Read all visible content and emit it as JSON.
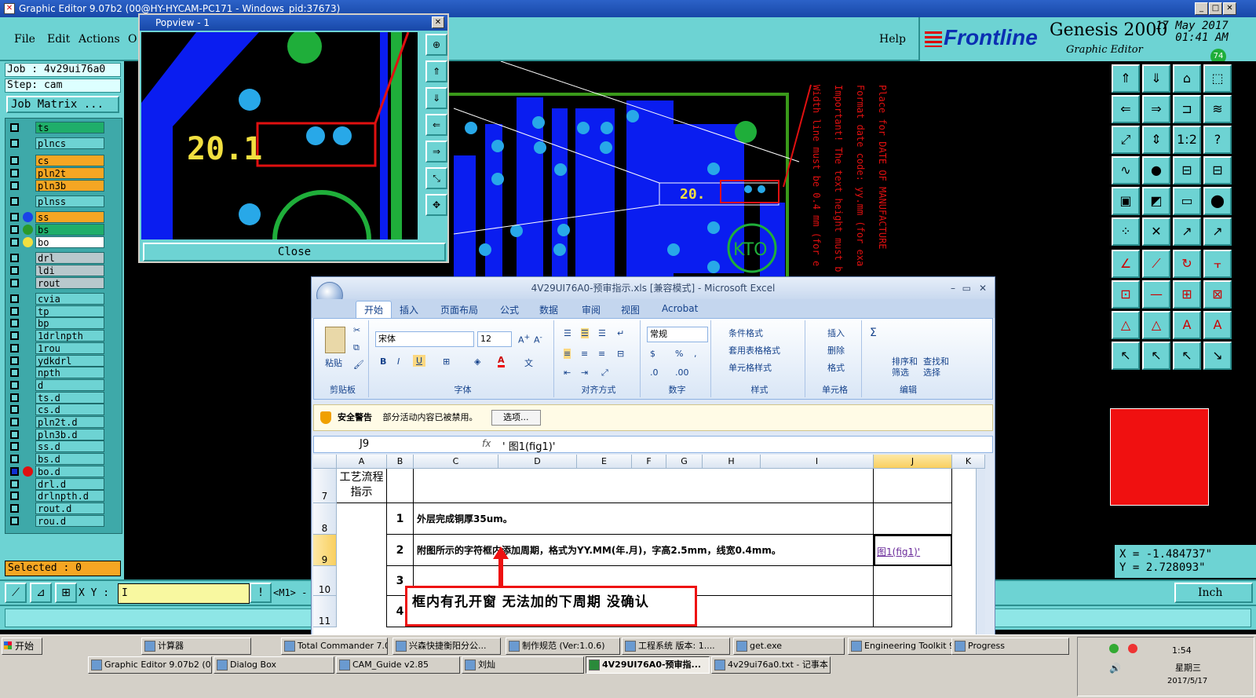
{
  "window": {
    "title": "Graphic Editor 9.07b2 (00@HY-HYCAM-PC171 - Windows_pid:37673)"
  },
  "menu": {
    "file": "File",
    "edit": "Edit",
    "actions": "Actions",
    "o": "O",
    "help": "Help"
  },
  "brand": {
    "logo": "Frontline",
    "product": "Genesis 2000",
    "subtitle": "Graphic Editor",
    "date": "17 May 2017",
    "time": "01:41 AM",
    "badge": "74"
  },
  "job": {
    "job": "Job : 4v29ui76a0",
    "step": "Step: cam",
    "matrix": "Job Matrix ..."
  },
  "layers": [
    {
      "name": "ts",
      "color": "#1fae6a"
    },
    {
      "name": "plncs",
      "color": "#6dd3d3"
    },
    {
      "name": "cs",
      "color": "#f5a623"
    },
    {
      "name": "pln2t",
      "color": "#f5a623"
    },
    {
      "name": "pln3b",
      "color": "#f5a623"
    },
    {
      "name": "plnss",
      "color": "#6dd3d3"
    },
    {
      "name": "ss",
      "color": "#f5a623"
    },
    {
      "name": "bs",
      "color": "#1fae6a"
    },
    {
      "name": "bo",
      "color": "#ffffff"
    },
    {
      "name": "drl",
      "color": "#b8c8cc"
    },
    {
      "name": "ldi",
      "color": "#b8c8cc"
    },
    {
      "name": "rout",
      "color": "#b8c8cc"
    },
    {
      "name": "cvia",
      "color": "#6dd3d3"
    },
    {
      "name": "tp",
      "color": "#6dd3d3"
    },
    {
      "name": "bp",
      "color": "#6dd3d3"
    },
    {
      "name": "1drlnpth",
      "color": "#6dd3d3"
    },
    {
      "name": "1rou",
      "color": "#6dd3d3"
    },
    {
      "name": "ydkdrl",
      "color": "#6dd3d3"
    },
    {
      "name": "npth",
      "color": "#6dd3d3"
    },
    {
      "name": "d",
      "color": "#6dd3d3"
    },
    {
      "name": "ts.d",
      "color": "#6dd3d3"
    },
    {
      "name": "cs.d",
      "color": "#6dd3d3"
    },
    {
      "name": "pln2t.d",
      "color": "#6dd3d3"
    },
    {
      "name": "pln3b.d",
      "color": "#6dd3d3"
    },
    {
      "name": "ss.d",
      "color": "#6dd3d3"
    },
    {
      "name": "bs.d",
      "color": "#6dd3d3"
    },
    {
      "name": "bo.d",
      "color": "#6dd3d3"
    },
    {
      "name": "drl.d",
      "color": "#6dd3d3"
    },
    {
      "name": "drlnpth.d",
      "color": "#6dd3d3"
    },
    {
      "name": "rout.d",
      "color": "#6dd3d3"
    },
    {
      "name": "rou.d",
      "color": "#6dd3d3"
    }
  ],
  "selected": "Selected : 0",
  "xy": {
    "label": "X Y :",
    "value": "I",
    "m1": "<M1> -"
  },
  "coords": {
    "x": "X = -1.484737\"",
    "y": "Y = 2.728093\""
  },
  "units": "Inch",
  "popview": {
    "title": "Popview - 1",
    "close": "Close",
    "text": "20.1"
  },
  "board": {
    "marking": "20.",
    "logo": "KTO",
    "note_lines": [
      "Place for DATE OF MANUFACTURE",
      "Format date code: yy.mm (for exa",
      "Important! The text height must b",
      "Width line must be 0.4 mm (for e"
    ]
  },
  "excel": {
    "title": "4V29UI76A0-预审指示.xls [兼容模式] - Microsoft Excel",
    "tabs": [
      "开始",
      "插入",
      "页面布局",
      "公式",
      "数据",
      "审阅",
      "视图",
      "Acrobat"
    ],
    "groups": {
      "clipboard": "剪贴板",
      "font": "字体",
      "align": "对齐方式",
      "number": "数字",
      "styles": "样式",
      "cells": "单元格",
      "editing": "编辑"
    },
    "buttons": {
      "paste": "粘贴",
      "cond_format": "条件格式",
      "table_format": "套用表格格式",
      "cell_style": "单元格样式",
      "insert": "插入",
      "delete": "删除",
      "format": "格式",
      "sort": "排序和\n筛选",
      "find": "查找和\n选择",
      "sigma": "Σ"
    },
    "font_name": "宋体",
    "font_size": "12",
    "number_format": "常规",
    "warning": {
      "label": "安全警告",
      "text": "部分活动内容已被禁用。",
      "options": "选项..."
    },
    "name_box": "J9",
    "fx": "fx",
    "formula": "' 图1(fig1)'",
    "columns": [
      "A",
      "B",
      "C",
      "D",
      "E",
      "F",
      "G",
      "H",
      "I",
      "J",
      "K"
    ],
    "rows": [
      {
        "num": "7",
        "a": "工艺流程\n指示",
        "b": "",
        "c": "",
        "j": ""
      },
      {
        "num": "8",
        "a": "",
        "b": "1",
        "c": "外层完成铜厚35um。",
        "j": ""
      },
      {
        "num": "9",
        "a": "",
        "b": "2",
        "c": "附图所示的字符框内添加周期，格式为YY.MM(年.月)，字高2.5mm，线宽0.4mm。",
        "j": "图1(fig1)'"
      },
      {
        "num": "10",
        "a": "",
        "b": "3",
        "c": "",
        "j": ""
      },
      {
        "num": "11",
        "a": "",
        "b": "4",
        "c": "",
        "j": ""
      }
    ]
  },
  "callout": "框内有孔开窗 无法加的下周期 没确认",
  "taskbar": {
    "start": "开始",
    "row1": [
      "计算器",
      "Total Commander 7.0...",
      "兴森快捷衡阳分公...",
      "制作规范 (Ver:1.0.6)",
      "工程系统  版本: 1....",
      "get.exe",
      "Engineering Toolkit 9....",
      "Progress"
    ],
    "row2": [
      "Graphic Editor 9.07b2 (0...",
      "Dialog Box",
      "CAM_Guide v2.85",
      "刘灿",
      "4V29UI76A0-预审指...",
      "4v29ui76a0.txt - 记事本"
    ],
    "clock": "1:54",
    "weekday": "星期三",
    "date": "2017/5/17"
  }
}
